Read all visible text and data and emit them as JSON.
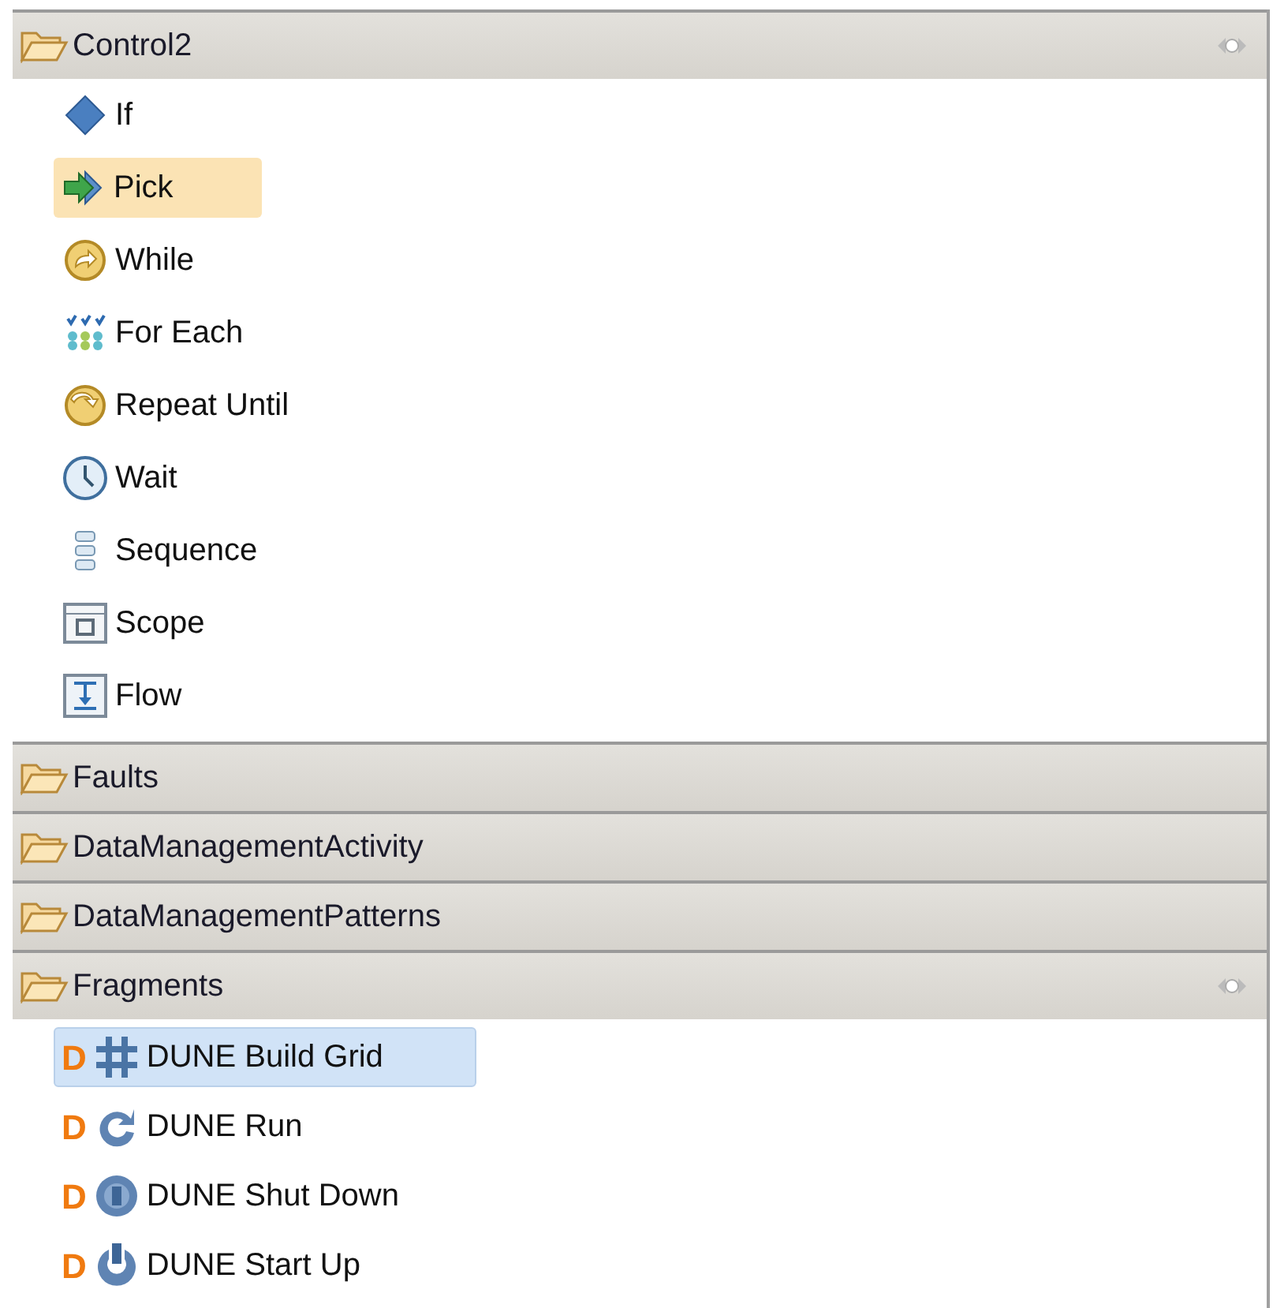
{
  "drawers": [
    {
      "label": "Control2",
      "expanded": true,
      "items": [
        {
          "label": "If",
          "kind": "diamond",
          "selected": false
        },
        {
          "label": "Pick",
          "kind": "pick",
          "selected": true
        },
        {
          "label": "While",
          "kind": "loop",
          "selected": false
        },
        {
          "label": "For Each",
          "kind": "foreach",
          "selected": false
        },
        {
          "label": "Repeat Until",
          "kind": "repeat",
          "selected": false
        },
        {
          "label": "Wait",
          "kind": "clock",
          "selected": false
        },
        {
          "label": "Sequence",
          "kind": "sequence",
          "selected": false
        },
        {
          "label": "Scope",
          "kind": "scope",
          "selected": false
        },
        {
          "label": "Flow",
          "kind": "flow",
          "selected": false
        }
      ]
    },
    {
      "label": "Faults",
      "expanded": false
    },
    {
      "label": "DataManagementActivity",
      "expanded": false
    },
    {
      "label": "DataManagementPatterns",
      "expanded": false
    },
    {
      "label": "Fragments",
      "expanded": true,
      "items": [
        {
          "label": "DUNE Build Grid",
          "prefix": "D",
          "kind": "grid",
          "selected": true
        },
        {
          "label": "DUNE Run",
          "prefix": "D",
          "kind": "run",
          "selected": false
        },
        {
          "label": "DUNE Shut Down",
          "prefix": "D",
          "kind": "shutdown",
          "selected": false
        },
        {
          "label": "DUNE Start Up",
          "prefix": "D",
          "kind": "startup",
          "selected": false
        }
      ]
    }
  ]
}
